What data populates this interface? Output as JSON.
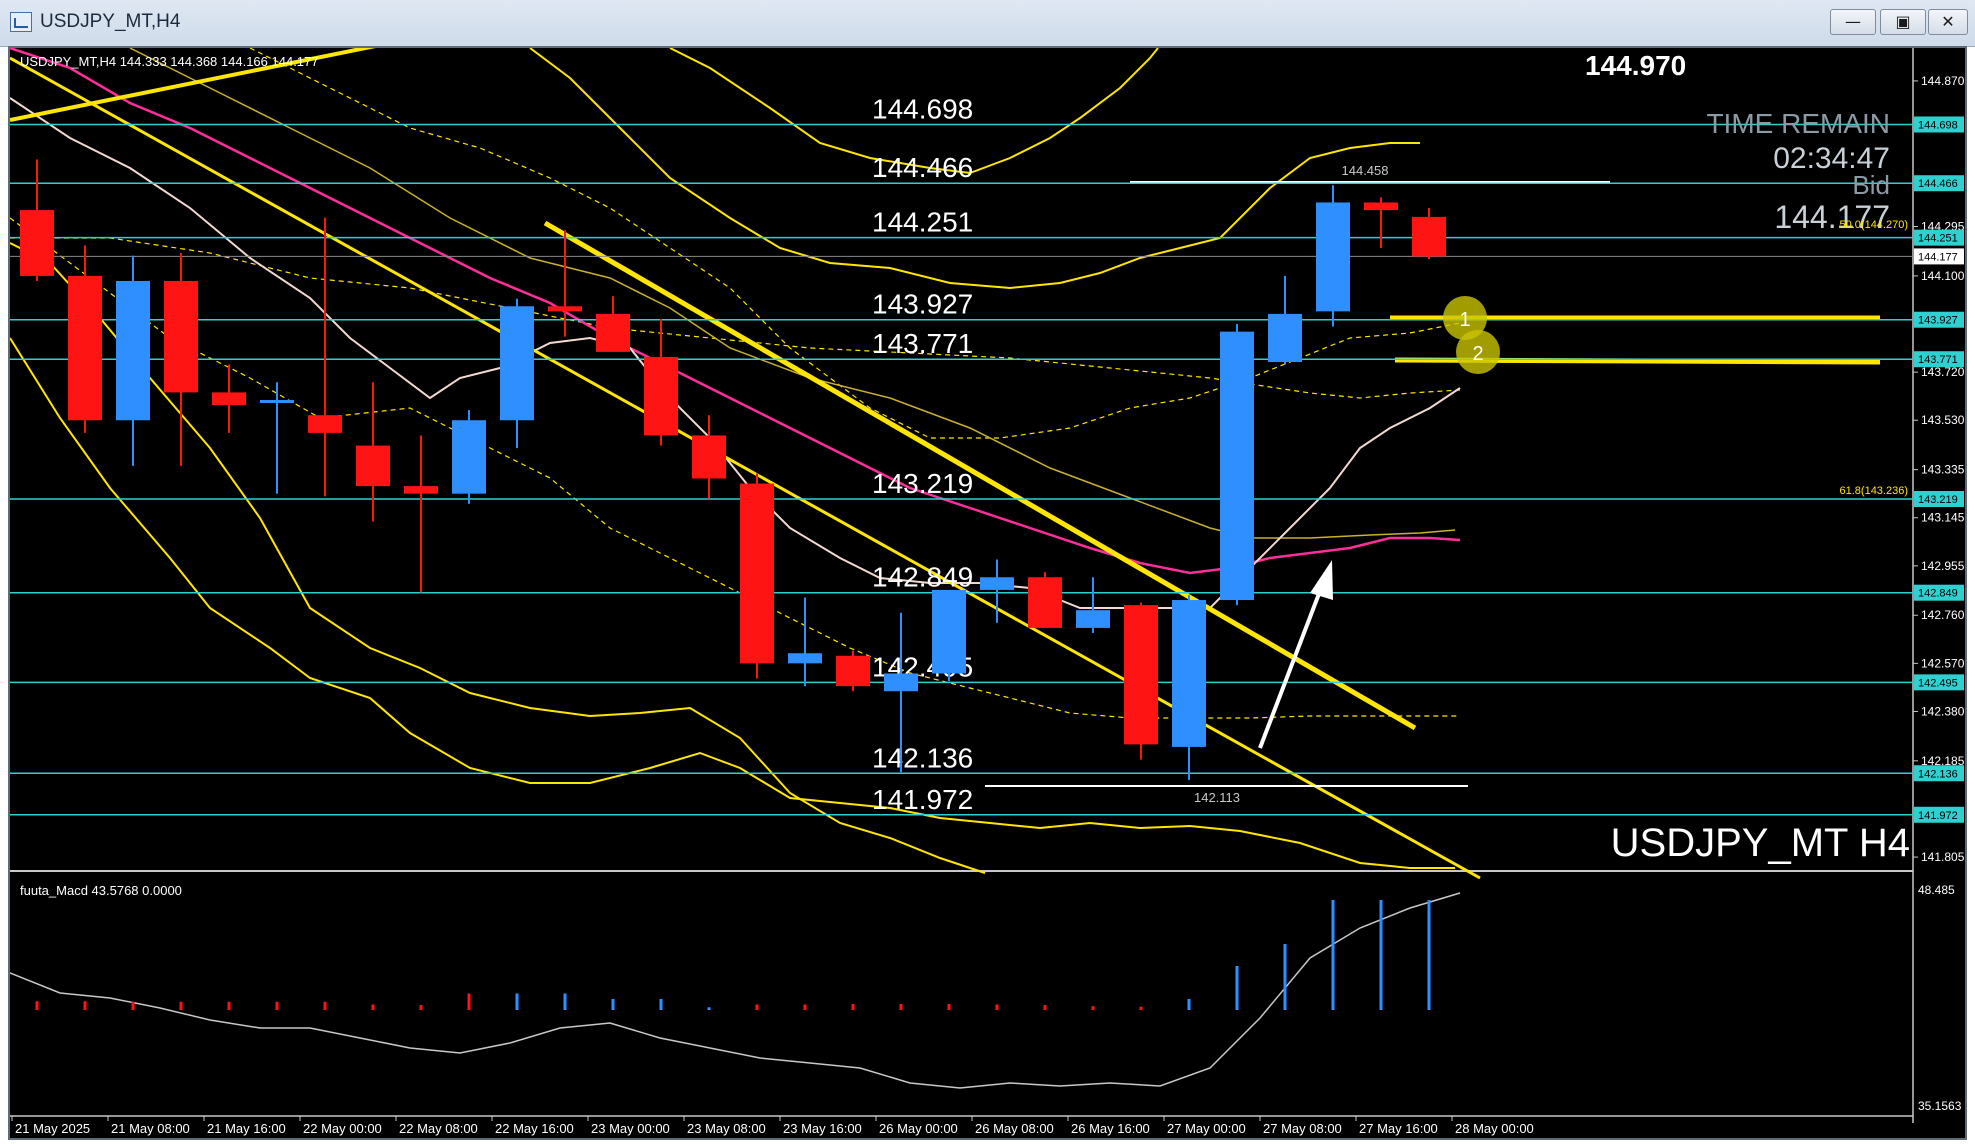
{
  "window": {
    "title": "USDJPY_MT,H4",
    "minimize_glyph": "—",
    "maximize_glyph": "▣",
    "close_glyph": "✕"
  },
  "chart": {
    "info_line": "USDJPY_MT,H4  144.333 144.368 144.166 144.177",
    "current_price_big": "144.970",
    "time_remain_label": "TIME REMAIN",
    "time_remain_value": "02:34:47",
    "bid_label": "Bid",
    "bid_value": "144.177",
    "symbol_label": "USDJPY_MT H4",
    "fib50_label": "50.0(144.270)",
    "fib618_label": "61.8(143.236)",
    "swing_high_label": "144.458",
    "swing_low_label": "142.113",
    "circle_labels": [
      "1",
      "2"
    ],
    "macd_label": "fuuta_Macd 43.5768   0.0000",
    "macd_axis_top": "48.485",
    "macd_axis_bottom": "35.1563"
  },
  "colors": {
    "background": "#000000",
    "bull_candle": "#2f8fff",
    "bear_candle": "#ff1414",
    "level_line": "#2fd0d0",
    "trend_line": "#ffe600",
    "ma_pink": "#ff2e9a",
    "ma_white": "#f2d8d0"
  },
  "chart_data": {
    "type": "candlestick",
    "symbol": "USDJPY_MT",
    "timeframe": "H4",
    "y_range": [
      141.75,
      145.0
    ],
    "x_labels": [
      "21 May 2025",
      "21 May 08:00",
      "21 May 16:00",
      "22 May 00:00",
      "22 May 08:00",
      "22 May 16:00",
      "23 May 00:00",
      "23 May 08:00",
      "23 May 16:00",
      "26 May 00:00",
      "26 May 08:00",
      "26 May 16:00",
      "27 May 00:00",
      "27 May 08:00",
      "27 May 16:00",
      "28 May 00:00"
    ],
    "price_axis_ticks": [
      "144.870",
      "144.295",
      "144.100",
      "143.720",
      "143.530",
      "143.335",
      "143.145",
      "142.955",
      "142.760",
      "142.570",
      "142.380",
      "142.185",
      "141.805"
    ],
    "level_lines": [
      144.698,
      144.466,
      144.251,
      143.927,
      143.771,
      143.219,
      142.849,
      142.495,
      142.136,
      141.972
    ],
    "level_labels": [
      "144.698",
      "144.466",
      "144.251",
      "143.927",
      "143.771",
      "143.219",
      "142.849",
      "142.495",
      "142.136",
      "141.972"
    ],
    "candles": [
      {
        "o": 144.36,
        "h": 144.56,
        "l": 144.08,
        "c": 144.1
      },
      {
        "o": 144.1,
        "h": 144.22,
        "l": 143.48,
        "c": 143.53
      },
      {
        "o": 143.53,
        "h": 144.18,
        "l": 143.35,
        "c": 144.08
      },
      {
        "o": 144.08,
        "h": 144.19,
        "l": 143.35,
        "c": 143.64
      },
      {
        "o": 143.64,
        "h": 143.75,
        "l": 143.48,
        "c": 143.59
      },
      {
        "o": 143.6,
        "h": 143.68,
        "l": 143.24,
        "c": 143.61
      },
      {
        "o": 143.55,
        "h": 144.33,
        "l": 143.23,
        "c": 143.48
      },
      {
        "o": 143.43,
        "h": 143.68,
        "l": 143.13,
        "c": 143.27
      },
      {
        "o": 143.27,
        "h": 143.47,
        "l": 142.85,
        "c": 143.24
      },
      {
        "o": 143.24,
        "h": 143.57,
        "l": 143.2,
        "c": 143.53
      },
      {
        "o": 143.53,
        "h": 144.01,
        "l": 143.42,
        "c": 143.98
      },
      {
        "o": 143.98,
        "h": 144.28,
        "l": 143.86,
        "c": 143.96
      },
      {
        "o": 143.95,
        "h": 144.02,
        "l": 143.83,
        "c": 143.8
      },
      {
        "o": 143.78,
        "h": 143.93,
        "l": 143.43,
        "c": 143.47
      },
      {
        "o": 143.47,
        "h": 143.55,
        "l": 143.22,
        "c": 143.3
      },
      {
        "o": 143.28,
        "h": 143.32,
        "l": 142.51,
        "c": 142.57
      },
      {
        "o": 142.57,
        "h": 142.83,
        "l": 142.48,
        "c": 142.61
      },
      {
        "o": 142.6,
        "h": 142.62,
        "l": 142.46,
        "c": 142.48
      },
      {
        "o": 142.46,
        "h": 142.77,
        "l": 142.14,
        "c": 142.53
      },
      {
        "o": 142.53,
        "h": 142.82,
        "l": 142.5,
        "c": 142.86
      },
      {
        "o": 142.86,
        "h": 142.98,
        "l": 142.73,
        "c": 142.91
      },
      {
        "o": 142.91,
        "h": 142.93,
        "l": 142.72,
        "c": 142.71
      },
      {
        "o": 142.71,
        "h": 142.91,
        "l": 142.69,
        "c": 142.78
      },
      {
        "o": 142.8,
        "h": 142.81,
        "l": 142.19,
        "c": 142.25
      },
      {
        "o": 142.24,
        "h": 142.84,
        "l": 142.11,
        "c": 142.82
      },
      {
        "o": 142.82,
        "h": 143.91,
        "l": 142.8,
        "c": 143.88
      },
      {
        "o": 143.76,
        "h": 144.1,
        "l": 143.75,
        "c": 143.95
      },
      {
        "o": 143.96,
        "h": 144.458,
        "l": 143.9,
        "c": 144.39
      },
      {
        "o": 144.39,
        "h": 144.41,
        "l": 144.21,
        "c": 144.36
      },
      {
        "o": 144.333,
        "h": 144.368,
        "l": 144.166,
        "c": 144.177
      }
    ]
  }
}
